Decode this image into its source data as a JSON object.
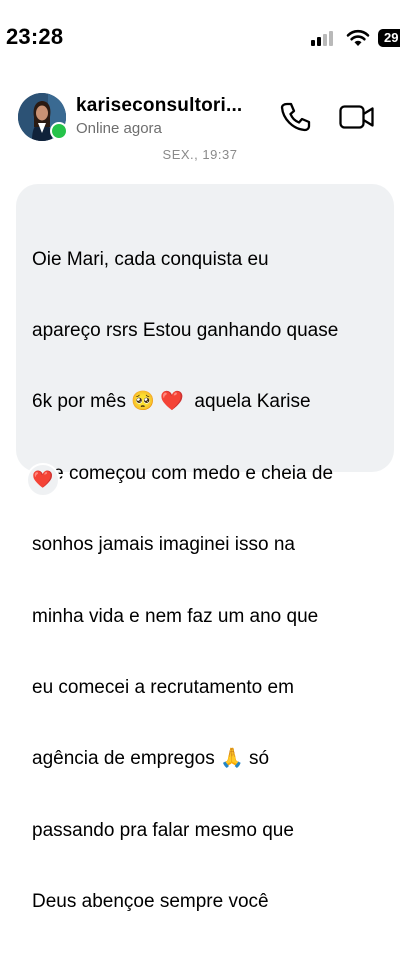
{
  "status_bar": {
    "time": "23:28",
    "battery_level": "29"
  },
  "header": {
    "contact_name": "kariseconsultori...",
    "contact_status": "Online agora",
    "icons": [
      "phone-icon",
      "video-camera-icon"
    ],
    "online": true
  },
  "chat": {
    "timestamp": "SEX., 19:37",
    "message": {
      "lines": [
        "Oie Mari, cada conquista eu",
        "apareço rsrs Estou ganhando quase",
        "6k por mês 🥺 ❤️  aquela Karise",
        "que começou com medo e cheia de",
        "sonhos jamais imaginei isso na",
        "minha vida e nem faz um ano que",
        "eu comecei a recrutamento em",
        "agência de empregos 🙏 só",
        "passando pra falar mesmo que",
        "Deus abençoe sempre você"
      ]
    },
    "reaction": "❤️"
  },
  "colors": {
    "bubble": "#eff1f3",
    "online": "#25c34a",
    "heart": "#e0245e"
  }
}
